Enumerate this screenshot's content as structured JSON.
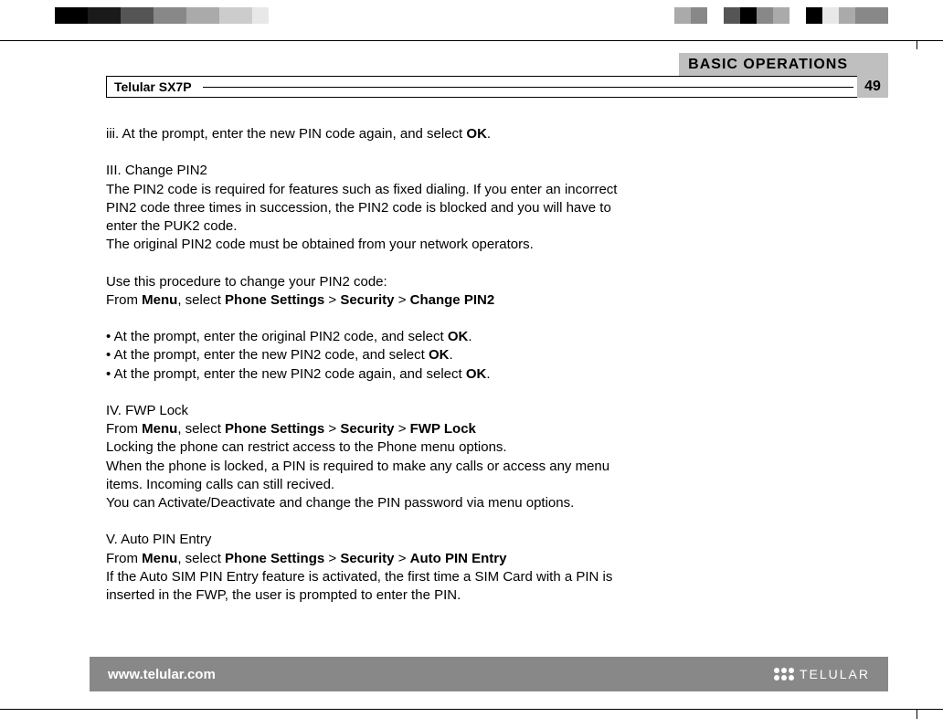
{
  "header": {
    "section_title": "BASIC OPERATIONS",
    "model": "Telular SX7P",
    "page_number": "49"
  },
  "body": {
    "line_iii_pre": "iii. At the prompt, enter the new PIN code again, and select ",
    "ok": "OK",
    "period": ".",
    "III_title": "III. Change PIN2",
    "III_p1": "The PIN2 code is required for features such as fixed dialing. If you enter an incorrect PIN2 code three times in succession, the PIN2 code is blocked and you will have to enter the PUK2 code.",
    "III_p2": "The original PIN2 code must be obtained from your network operators.",
    "III_use": "Use this procedure to change your PIN2 code:",
    "from": "From ",
    "menu": "Menu",
    "sel": ", select ",
    "phone_settings": "Phone Settings",
    "gt": " > ",
    "security": "Security",
    "change_pin2": "Change PIN2",
    "bullet1_pre": "• At the prompt, enter the original PIN2 code, and select ",
    "bullet2_pre": "• At the prompt, enter the new PIN2 code, and select ",
    "bullet3_pre": "• At the prompt, enter the new PIN2 code again, and select ",
    "IV_title": "IV. FWP Lock",
    "fwp_lock": "FWP Lock",
    "IV_p1": "Locking the phone can restrict access to the Phone menu options.",
    "IV_p2": "When the phone is locked, a PIN is required to make any calls or access any menu items. Incoming calls can still recived.",
    "IV_p3": "You can Activate/Deactivate and change the PIN password via menu options.",
    "V_title": "V. Auto PIN Entry",
    "auto_pin": "Auto PIN Entry",
    "V_p1": "If the Auto SIM PIN Entry feature is activated, the first time a SIM Card with a PIN is inserted in the FWP, the user is prompted to enter the PIN."
  },
  "footer": {
    "url": "www.telular.com",
    "brand": "TELULAR"
  },
  "colors": {
    "top_squares_left": [
      "#000",
      "#000",
      "#1a1a1a",
      "#1a1a1a",
      "#555",
      "#555",
      "#888",
      "#888",
      "#aaa",
      "#aaa",
      "#ccc",
      "#ccc",
      "#e8e8e8",
      "#fff",
      "#fff"
    ],
    "top_squares_right": [
      "#aaa",
      "#888",
      "#fff",
      "#555",
      "#000",
      "#888",
      "#aaa",
      "#fff",
      "#000",
      "#e8e8e8",
      "#aaa",
      "#888",
      "#888"
    ]
  }
}
